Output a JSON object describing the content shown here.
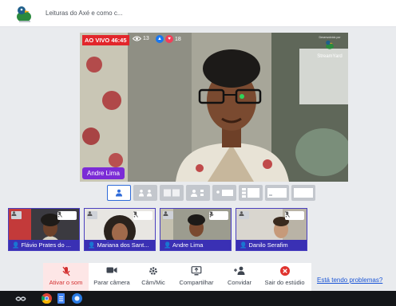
{
  "header": {
    "title": "Leituras do Axé e como c..."
  },
  "stage": {
    "live_badge": "AO VIVO 46:45",
    "viewers": "13",
    "reactions": "18",
    "watermark_by": "Desenvolvido por",
    "watermark_brand": "StreamYard",
    "host_name": "Andre Lima"
  },
  "participants": [
    {
      "name": "Flávio Prates do ..."
    },
    {
      "name": "Mariana dos Sant..."
    },
    {
      "name": "Andre Lima"
    },
    {
      "name": "Danilo Serafim"
    }
  ],
  "controls": {
    "unmute": "Ativar o som",
    "stop_camera": "Parar câmera",
    "cam_mic": "Câm/Mic",
    "share": "Compartilhar",
    "invite": "Convidar",
    "leave": "Sair do estúdio"
  },
  "help_link": "Está tendo problemas?",
  "colors": {
    "live": "#e2262b",
    "name_tag": "#7b2bd6",
    "participant_bar": "#3a30b4",
    "accent": "#2f6bd9",
    "mute": "#d32f2f"
  }
}
